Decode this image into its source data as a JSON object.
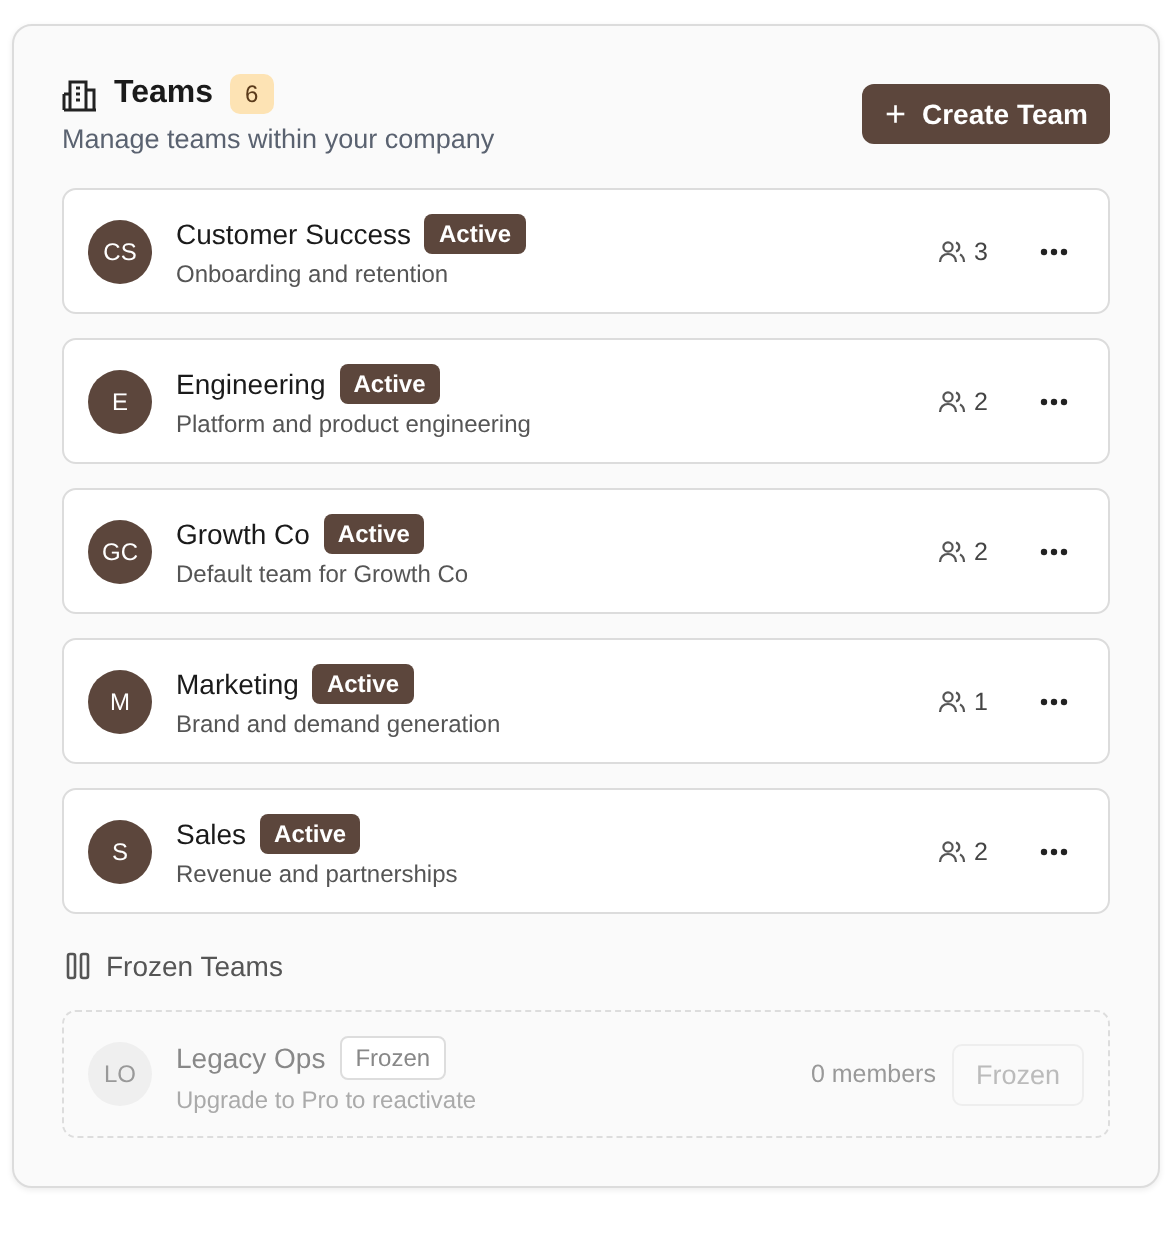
{
  "header": {
    "title": "Teams",
    "count": "6",
    "subtitle": "Manage teams within your company",
    "create_button": {
      "icon": "+",
      "label": "Create Team"
    }
  },
  "teams": [
    {
      "initials": "CS",
      "name": "Customer Success",
      "status": "Active",
      "description": "Onboarding and retention",
      "members": "3"
    },
    {
      "initials": "E",
      "name": "Engineering",
      "status": "Active",
      "description": "Platform and product engineering",
      "members": "2"
    },
    {
      "initials": "GC",
      "name": "Growth Co",
      "status": "Active",
      "description": "Default team for Growth Co",
      "members": "2"
    },
    {
      "initials": "M",
      "name": "Marketing",
      "status": "Active",
      "description": "Brand and demand generation",
      "members": "1"
    },
    {
      "initials": "S",
      "name": "Sales",
      "status": "Active",
      "description": "Revenue and partnerships",
      "members": "2"
    }
  ],
  "frozen_section": {
    "title": "Frozen Teams",
    "teams": [
      {
        "initials": "LO",
        "name": "Legacy Ops",
        "status": "Frozen",
        "description": "Upgrade to Pro to reactivate",
        "members": "0 members",
        "button": "Frozen"
      }
    ]
  }
}
